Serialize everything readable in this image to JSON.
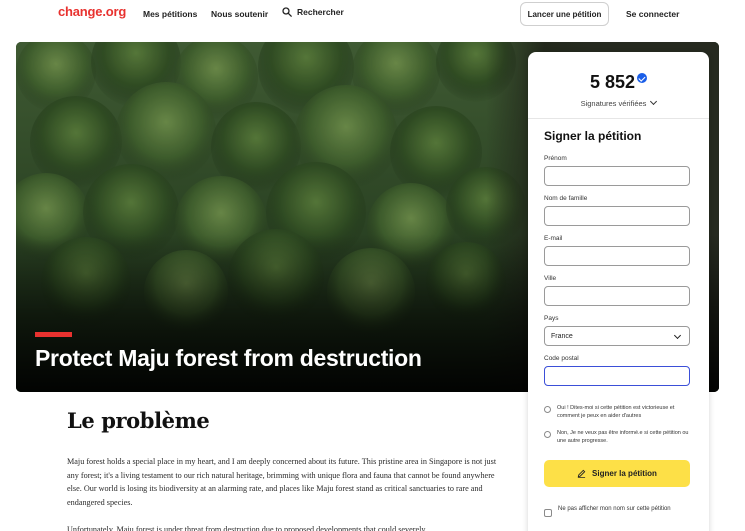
{
  "header": {
    "logo": "change.org",
    "nav": [
      "Mes pétitions",
      "Nous soutenir"
    ],
    "search_label": "Rechercher",
    "start_button": "Lancer une pétition",
    "login": "Se connecter",
    "brand_color": "#e8322f"
  },
  "hero": {
    "title": "Protect Maju forest from destruction",
    "accent_color": "#e8322f"
  },
  "sign_card": {
    "signature_count": "5 852",
    "signature_label": "Signatures vérifiées",
    "heading": "Signer la pétition",
    "fields": {
      "first_name_label": "Prénom",
      "last_name_label": "Nom de famille",
      "email_label": "E-mail",
      "city_label": "Ville",
      "country_label": "Pays",
      "country_value": "France",
      "postal_label": "Code postal"
    },
    "radio_yes": "Oui ! Dites-moi si cette pétition est victorieuse et comment je peux en aider d'autres",
    "radio_no": "Non, Je ne veux pas être informé.e si cette pétition ou une autre progresse.",
    "sign_button": "Signer la pétition",
    "hide_name": "Ne pas afficher mon nom sur cette pétition",
    "button_color": "#fde047",
    "verified_color": "#1a5ee8"
  },
  "article": {
    "heading": "Le problème",
    "paragraph1": "Maju forest holds a special place in my heart, and I am deeply concerned about its future. This pristine area in Singapore is not just any forest; it's a living testament to our rich natural heritage, brimming with unique flora and fauna that cannot be found anywhere else. Our world is losing its biodiversity at an alarming rate, and places like Maju forest stand as critical sanctuaries to rare and endangered species.",
    "paragraph2": "Unfortunately, Maju forest is under threat from destruction due to proposed developments that could severely"
  }
}
